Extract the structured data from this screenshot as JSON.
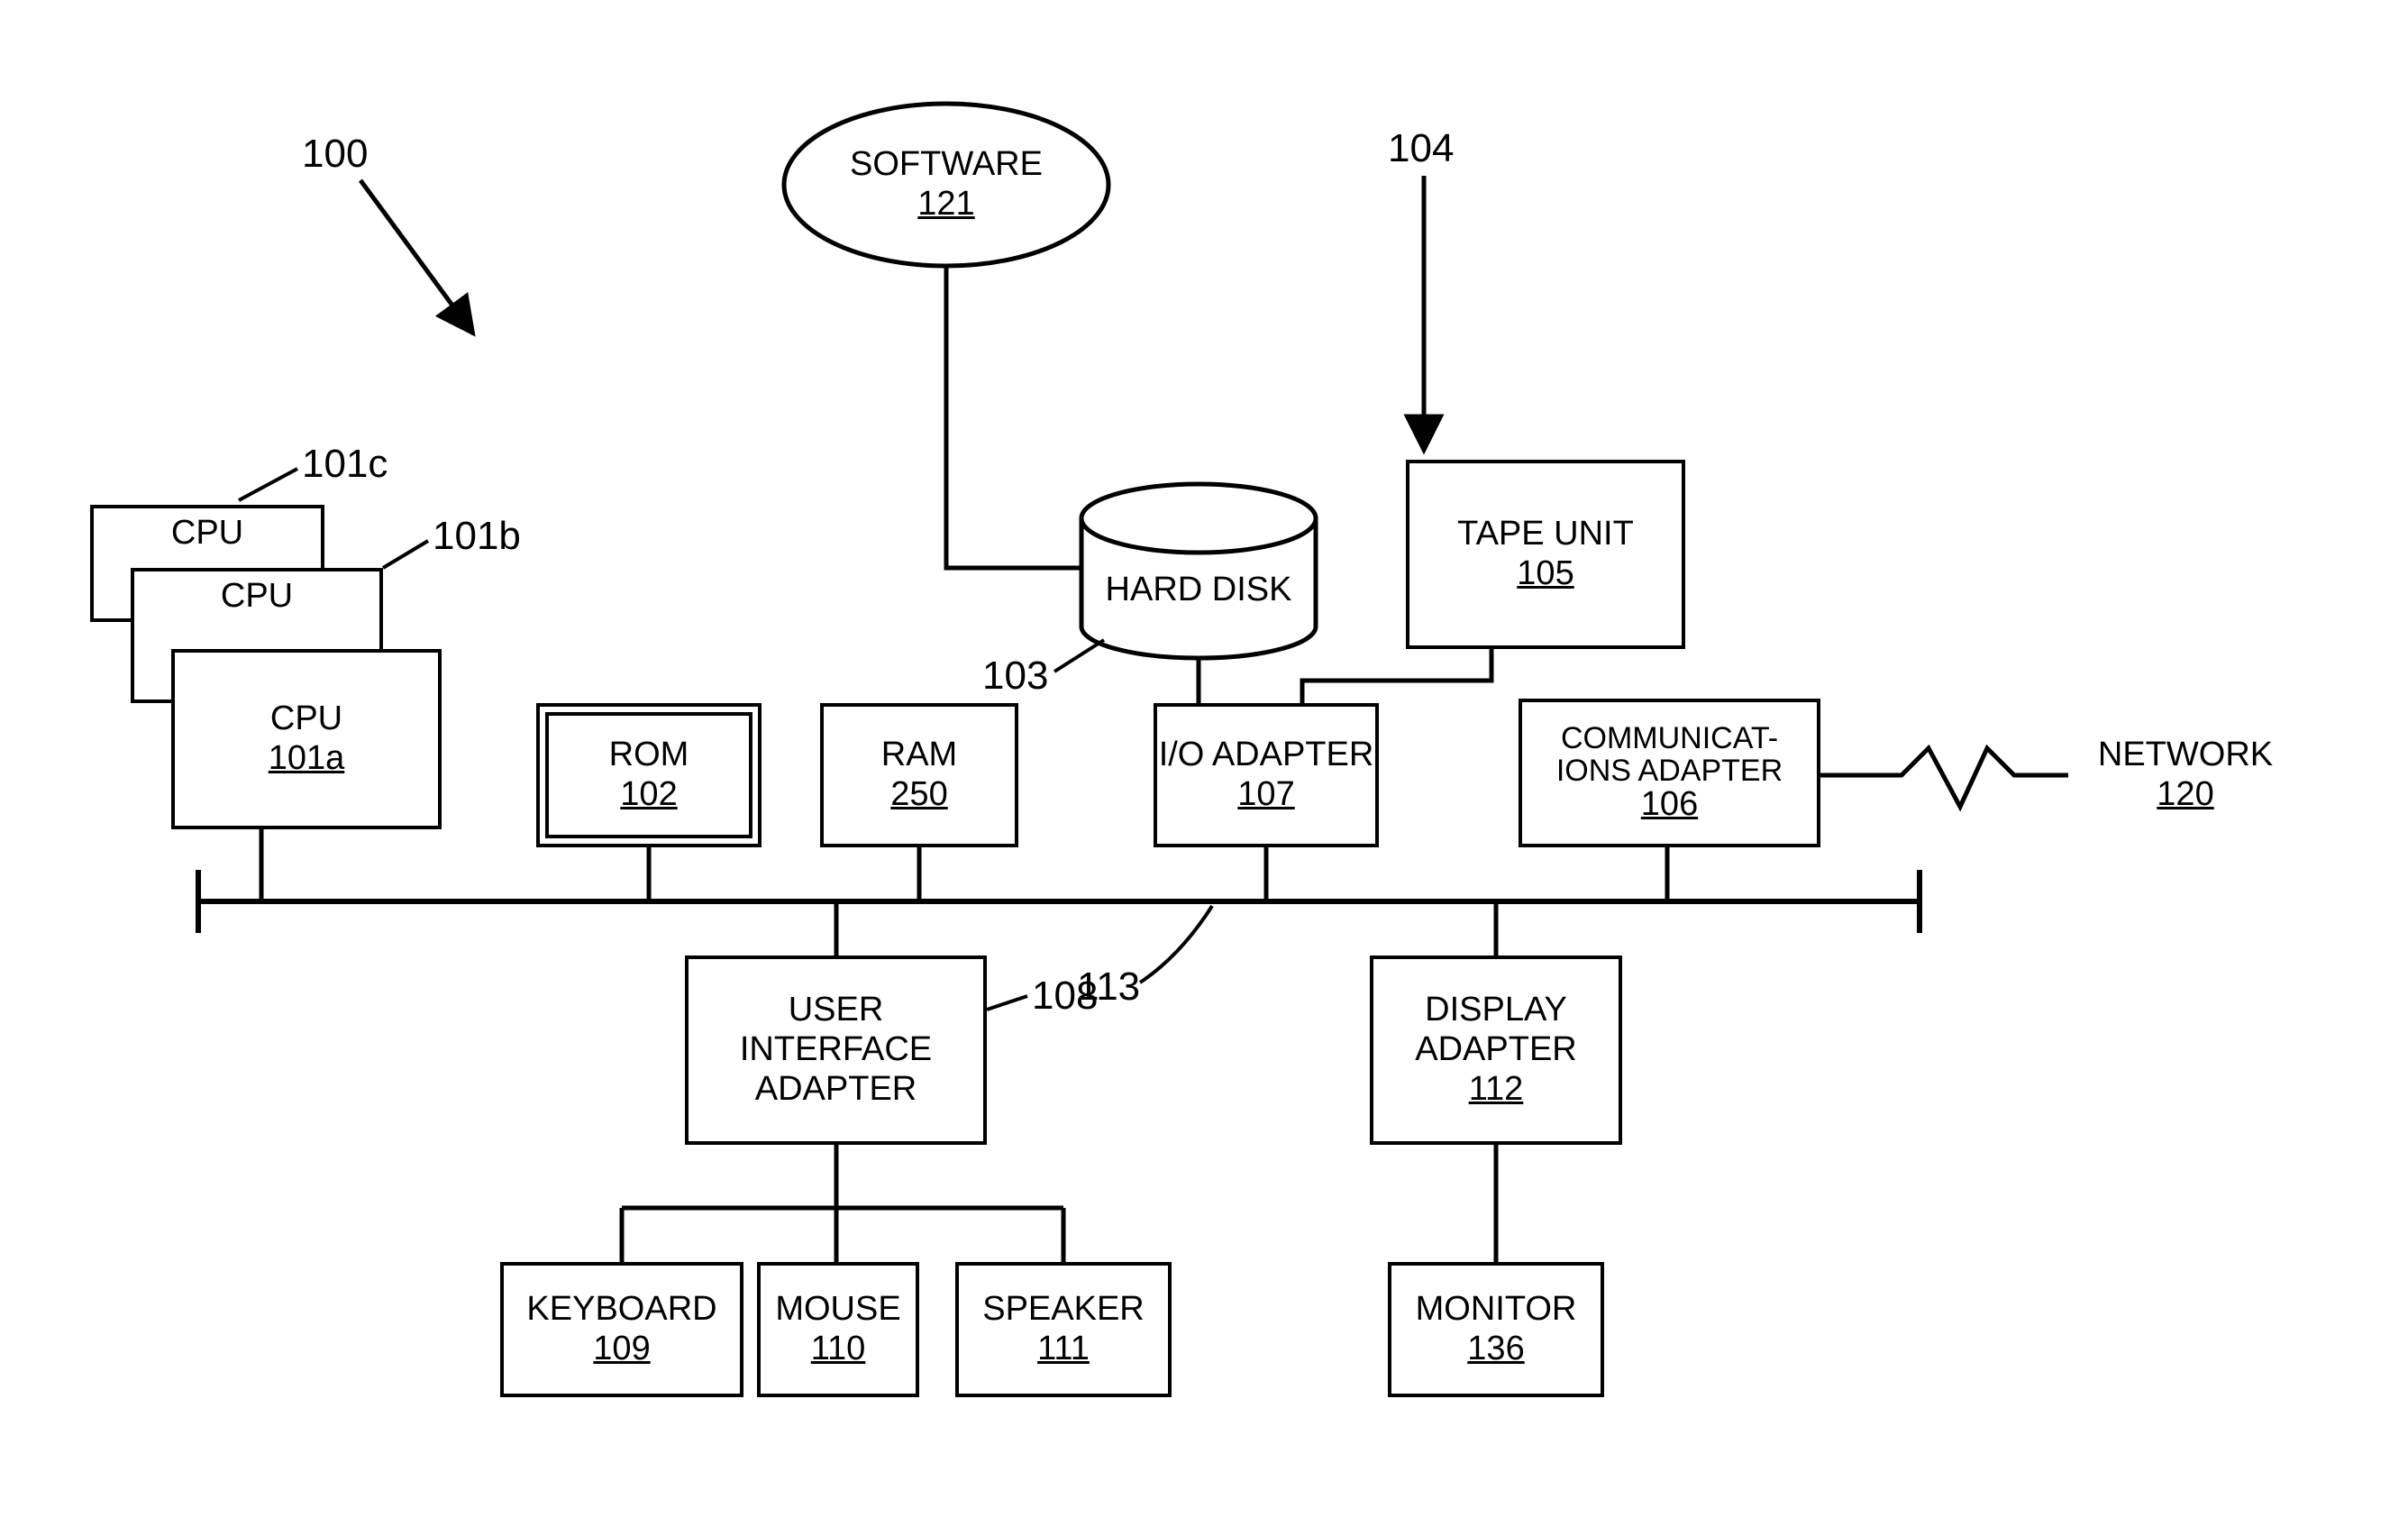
{
  "refs": {
    "system": "100",
    "cpu_a": "101a",
    "cpu_b": "101b",
    "cpu_c": "101c",
    "rom": "102",
    "harddisk": "103",
    "tape_lead": "104",
    "tape": "105",
    "comm": "106",
    "io": "107",
    "ui": "108",
    "keyboard": "109",
    "mouse": "110",
    "speaker": "111",
    "display": "112",
    "bus": "113",
    "network": "120",
    "software": "121",
    "monitor": "136",
    "ram": "250"
  },
  "labels": {
    "cpu": "CPU",
    "rom": "ROM",
    "ram": "RAM",
    "harddisk": "HARD DISK",
    "tape": "TAPE UNIT",
    "io": "I/O ADAPTER",
    "comm": "COMMUNICAT- IONS ADAPTER",
    "ui": "USER INTERFACE ADAPTER",
    "display": "DISPLAY ADAPTER",
    "keyboard": "KEYBOARD",
    "mouse": "MOUSE",
    "speaker": "SPEAKER",
    "monitor": "MONITOR",
    "software": "SOFTWARE",
    "network": "NETWORK"
  }
}
